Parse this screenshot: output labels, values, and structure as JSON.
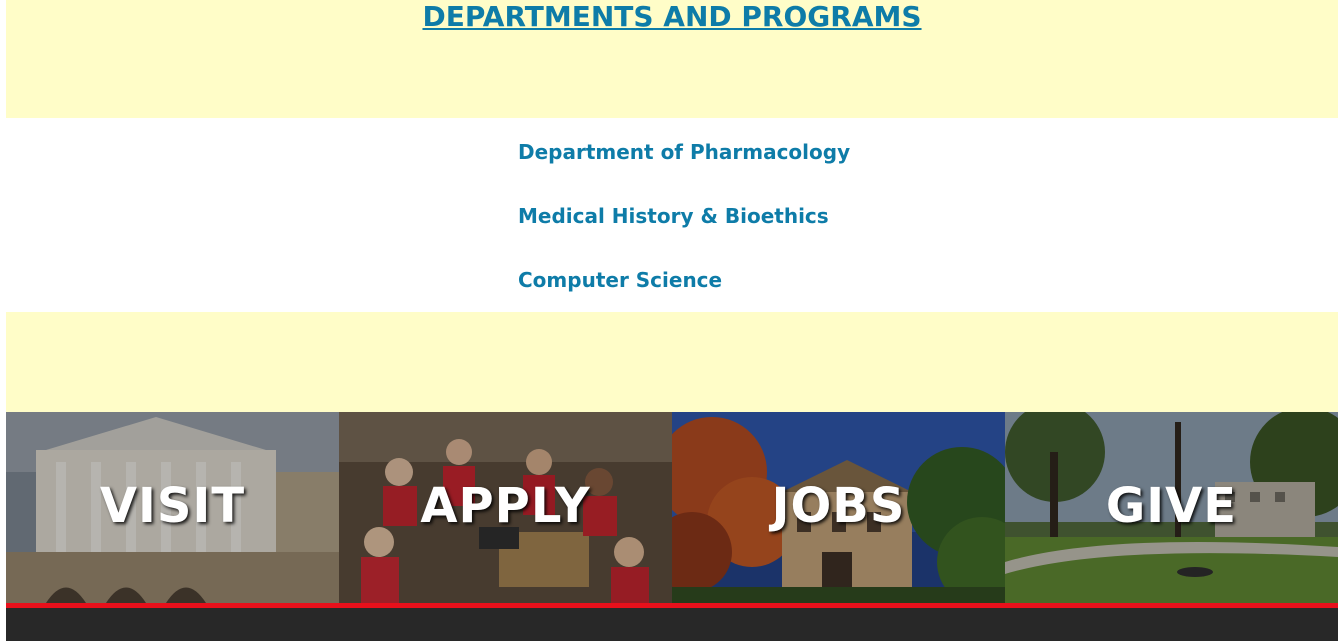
{
  "section": {
    "title": "DEPARTMENTS AND PROGRAMS"
  },
  "departments": [
    {
      "label": "Department of Pharmacology"
    },
    {
      "label": "Medical History & Bioethics"
    },
    {
      "label": "Computer Science"
    }
  ],
  "tiles": [
    {
      "label": "VISIT",
      "image": "campus-building-photo"
    },
    {
      "label": "APPLY",
      "image": "students-group-photo"
    },
    {
      "label": "JOBS",
      "image": "autumn-campus-photo"
    },
    {
      "label": "GIVE",
      "image": "campus-lawn-photo"
    }
  ],
  "colors": {
    "link": "#0e7ca8",
    "band": "#fffdc8",
    "accent_bar": "#e8101b",
    "footer": "#282828"
  }
}
